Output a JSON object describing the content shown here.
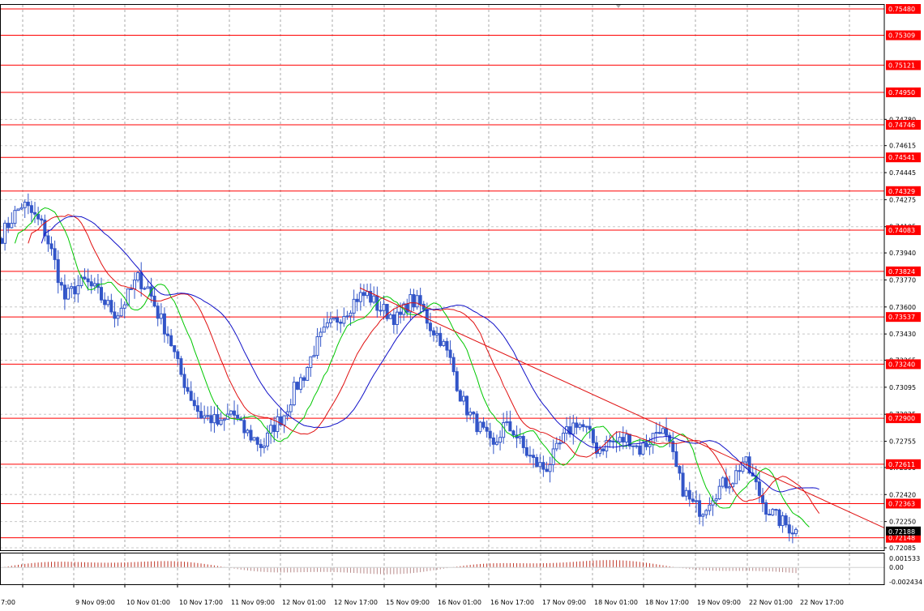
{
  "chart_data": {
    "type": "candlestick",
    "symbol": "",
    "price_axis": {
      "min": 0.72085,
      "max": 0.7548,
      "tick_labels": [
        "0.74780",
        "0.74615",
        "0.74445",
        "0.74275",
        "0.74105",
        "0.73940",
        "0.73770",
        "0.73600",
        "0.73430",
        "0.73265",
        "0.73095",
        "0.72925",
        "0.72755",
        "0.72590",
        "0.72420",
        "0.72250",
        "0.72085"
      ]
    },
    "time_axis": {
      "labels": [
        "7:00",
        "9 Nov 09:00",
        "10 Nov 01:00",
        "10 Nov 17:00",
        "11 Nov 09:00",
        "12 Nov 01:00",
        "12 Nov 17:00",
        "15 Nov 09:00",
        "16 Nov 01:00",
        "16 Nov 17:00",
        "17 Nov 09:00",
        "18 Nov 01:00",
        "18 Nov 17:00",
        "19 Nov 09:00",
        "22 Nov 01:00",
        "22 Nov 17:00"
      ]
    },
    "horizontal_levels": [
      0.7548,
      0.75309,
      0.75121,
      0.7495,
      0.74746,
      0.74541,
      0.74329,
      0.74083,
      0.73824,
      0.73537,
      0.7324,
      0.729,
      0.72611,
      0.72363,
      0.72148
    ],
    "current_price": 0.72188,
    "trendline": {
      "from_price": 0.7372,
      "to_price": 0.7221
    },
    "close_path": [
      0.7405,
      0.7416,
      0.7425,
      0.7418,
      0.741,
      0.739,
      0.7365,
      0.7372,
      0.7376,
      0.737,
      0.7362,
      0.7355,
      0.7366,
      0.7378,
      0.7372,
      0.7355,
      0.7342,
      0.732,
      0.7305,
      0.7292,
      0.729,
      0.7285,
      0.7295,
      0.7283,
      0.7278,
      0.7272,
      0.7285,
      0.7292,
      0.7308,
      0.7318,
      0.7335,
      0.7345,
      0.7352,
      0.7358,
      0.7366,
      0.7368,
      0.736,
      0.7356,
      0.7352,
      0.7364,
      0.7362,
      0.7348,
      0.734,
      0.7325,
      0.7302,
      0.729,
      0.7282,
      0.727,
      0.7285,
      0.7282,
      0.727,
      0.7262,
      0.7258,
      0.7268,
      0.728,
      0.7288,
      0.7282,
      0.727,
      0.7275,
      0.7275,
      0.7278,
      0.727,
      0.7276,
      0.7285,
      0.727,
      0.7248,
      0.7236,
      0.7232,
      0.7242,
      0.7248,
      0.7252,
      0.7264,
      0.725,
      0.7235,
      0.7228,
      0.7223,
      0.7219
    ],
    "oscillator": {
      "tick_labels": [
        "0.001533",
        "0.00",
        "-0.002434"
      ],
      "max": 0.001533,
      "min": -0.002434
    }
  },
  "colors": {
    "level_line": "#ff0000",
    "level_label_bg": "#ff0000",
    "candles": "#3255c8",
    "ma_fast": "#00c800",
    "ma_mid": "#e01010",
    "ma_slow": "#1010c8",
    "trendline": "#e01010",
    "grid": "#a8a8a8",
    "osc_negative": "#b98a8a",
    "osc_positive": "#c0392b"
  }
}
